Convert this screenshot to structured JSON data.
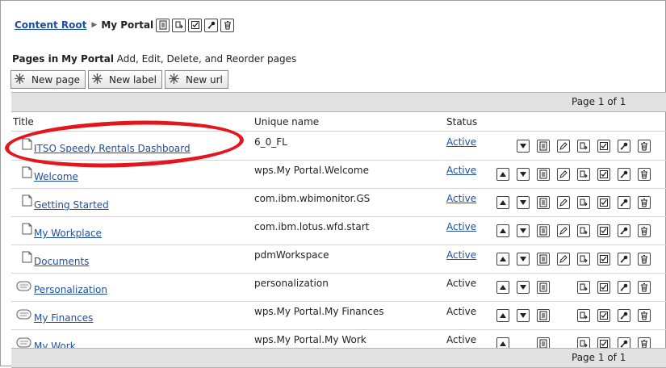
{
  "breadcrumb": {
    "root_link": "Content Root",
    "current": "My Portal"
  },
  "heading": {
    "prefix": "Pages in",
    "portal": "My Portal",
    "suffix": "Add, Edit, Delete, and Reorder pages"
  },
  "actions": {
    "new_page": "New page",
    "new_label": "New label",
    "new_url": "New url"
  },
  "pagination": {
    "top": "Page 1 of 1",
    "bottom": "Page 1 of 1"
  },
  "columns": {
    "title": "Title",
    "unique_name": "Unique name",
    "status": "Status"
  },
  "rows": [
    {
      "title": "ITSO Speedy Rentals Dashboard",
      "unique_name": "6_0_FL",
      "status": "Active",
      "icon": "page-icon",
      "status_link": true
    },
    {
      "title": "Welcome",
      "unique_name": "wps.My Portal.Welcome",
      "status": "Active",
      "icon": "page-icon",
      "status_link": true
    },
    {
      "title": "Getting Started",
      "unique_name": "com.ibm.wbimonitor.GS",
      "status": "Active",
      "icon": "page-icon",
      "status_link": true
    },
    {
      "title": "My Workplace",
      "unique_name": "com.ibm.lotus.wfd.start",
      "status": "Active",
      "icon": "page-icon",
      "status_link": true
    },
    {
      "title": "Documents",
      "unique_name": "pdmWorkspace",
      "status": "Active",
      "icon": "page-icon",
      "status_link": true
    },
    {
      "title": "Personalization",
      "unique_name": "personalization",
      "status": "Active",
      "icon": "label-icon",
      "status_link": false
    },
    {
      "title": "My Finances",
      "unique_name": "wps.My Portal.My Finances",
      "status": "Active",
      "icon": "label-icon",
      "status_link": false
    },
    {
      "title": "My Work",
      "unique_name": "wps.My Portal.My Work",
      "status": "Active",
      "icon": "label-icon",
      "status_link": false
    }
  ],
  "accent": {
    "link": "#1f4fa0",
    "highlight_oval": "#e3161d"
  }
}
